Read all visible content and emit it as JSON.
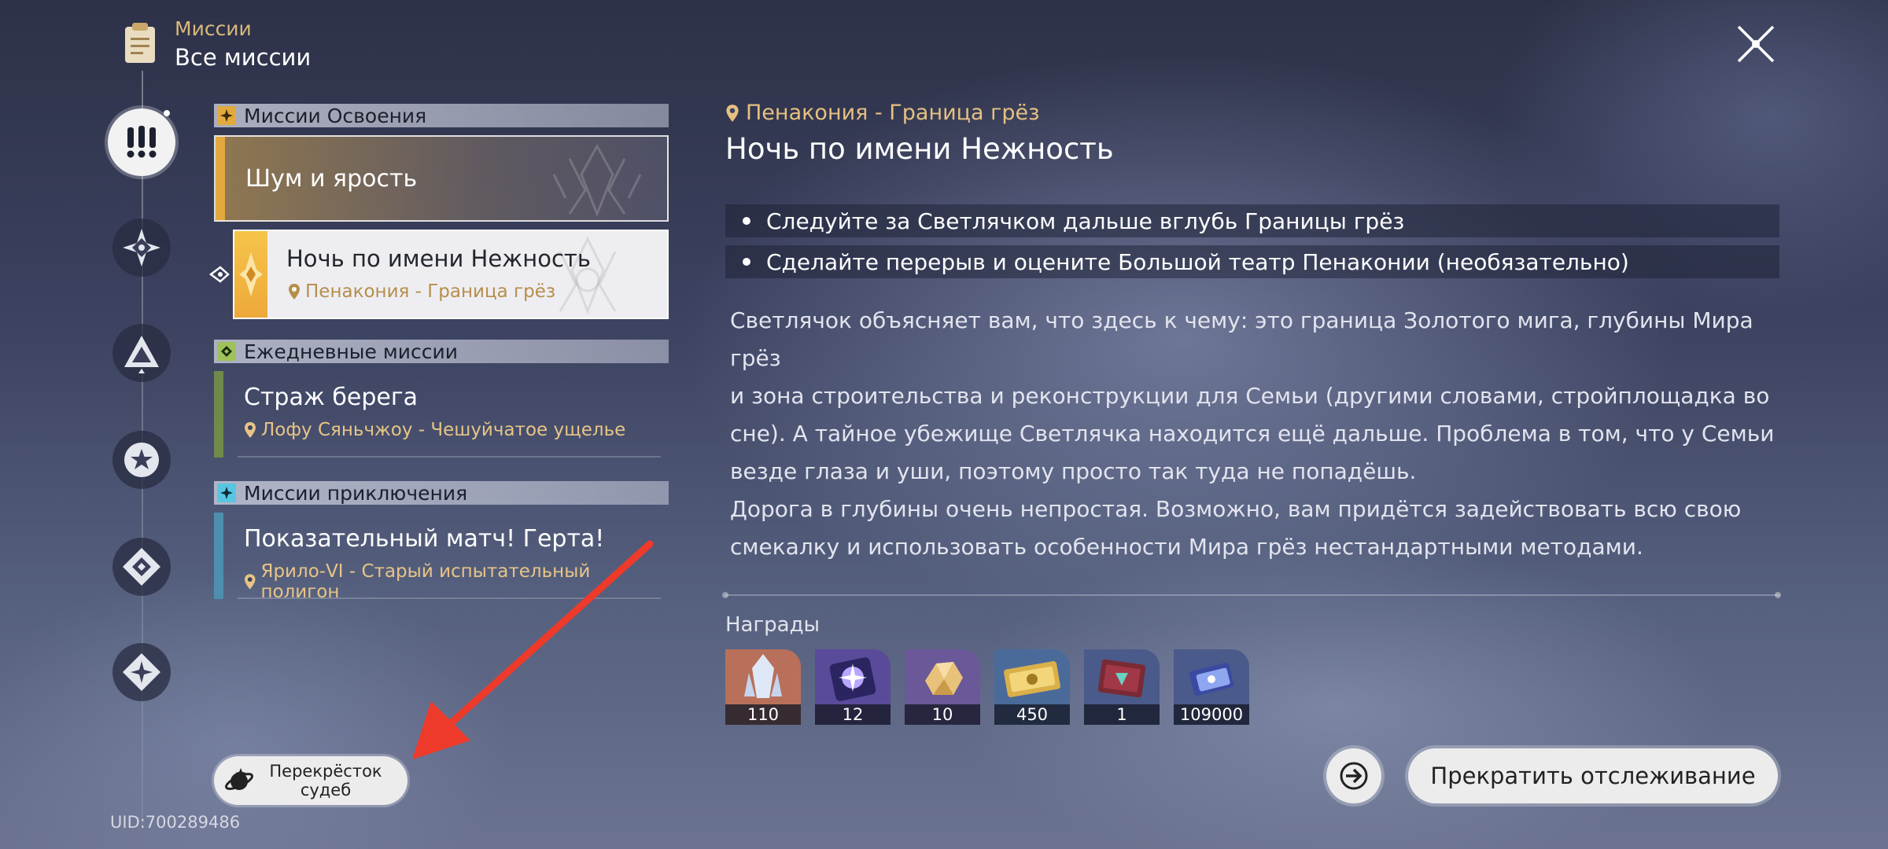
{
  "header": {
    "category": "Миссии",
    "title": "Все миссии",
    "icon": "clipboard-icon",
    "close_icon": "close-x-icon"
  },
  "sidebar": {
    "items": [
      {
        "icon": "exclamation-icon",
        "active": true
      },
      {
        "icon": "diamond-star-icon",
        "active": false
      },
      {
        "icon": "triangle-icon",
        "active": false
      },
      {
        "icon": "star-icon",
        "active": false
      },
      {
        "icon": "diamond-icon",
        "active": false
      },
      {
        "icon": "diamond-sparkle-icon",
        "active": false
      }
    ]
  },
  "mission_list": {
    "sections": [
      {
        "label": "Миссии Освоения",
        "badge_color": "#e2aa3e",
        "parent": {
          "name": "Шум и ярость"
        },
        "selected": {
          "name": "Ночь по имени Нежность",
          "location": "Пенакония - Граница грёз"
        }
      },
      {
        "label": "Ежедневные миссии",
        "badge_color": "#9ec25a",
        "item": {
          "name": "Страж берега",
          "location": "Лофу Сяньчжоу - Чешуйчатое ущелье",
          "stripe_color": "#6f8a4a"
        }
      },
      {
        "label": "Миссии приключения",
        "badge_color": "#57c6e2",
        "item": {
          "name": "Показательный матч! Герта!",
          "location": "Ярило-VI - Старый испытательный полигон",
          "stripe_color": "#4e8fae"
        }
      }
    ]
  },
  "detail": {
    "location": "Пенакония - Граница грёз",
    "title": "Ночь по имени Нежность",
    "objectives": [
      "Следуйте за Светлячком дальше вглубь Границы грёз",
      "Сделайте перерыв и оцените Большой театр Пенаконии (необязательно)"
    ],
    "description": [
      "Светлячок объясняет вам, что здесь к чему: это граница Золотого мига, глубины Мира грёз",
      "и зона строительства и реконструкции для Семьи (другими словами, стройплощадка во",
      "сне). А тайное убежище Светлячка находится ещё дальше. Проблема в том, что у Семьи",
      "везде глаза и уши, поэтому просто так туда не попадёшь.",
      "Дорога в глубины очень непростая. Возможно, вам придётся задействовать всю свою",
      "смекалку и использовать особенности Мира грёз нестандартными методами."
    ],
    "rewards_label": "Награды",
    "rewards": [
      {
        "icon": "crystal-icon",
        "qty": "110",
        "bg": "#b8705a"
      },
      {
        "icon": "star-rail-pass-icon",
        "qty": "12",
        "bg": "#5a4a9a"
      },
      {
        "icon": "gold-ore-icon",
        "qty": "10",
        "bg": "#6a5898"
      },
      {
        "icon": "credit-ticket-icon",
        "qty": "450",
        "bg": "#4a6a9a"
      },
      {
        "icon": "book-icon",
        "qty": "1",
        "bg": "#4a5a8a"
      },
      {
        "icon": "credits-icon",
        "qty": "109000",
        "bg": "#4a5a8a"
      }
    ]
  },
  "footer": {
    "crossroads_button": "Перекрёсток судеб",
    "track_icon": "teleport-icon",
    "stop_tracking_button": "Прекратить отслеживание",
    "uid": "UID:700289486"
  },
  "annotation_arrow_color": "#ee3a2a"
}
